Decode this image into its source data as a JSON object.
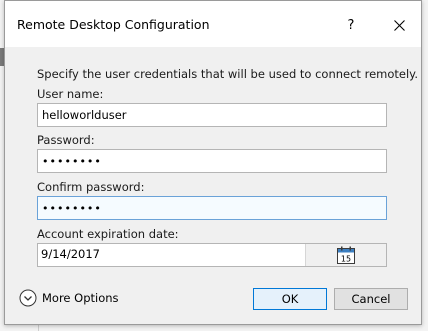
{
  "window": {
    "title": "Remote Desktop Configuration",
    "help_label": "?"
  },
  "form": {
    "description": "Specify the user credentials that will be used to connect remotely.",
    "username": {
      "label": "User name:",
      "value": "helloworlduser"
    },
    "password": {
      "label": "Password:",
      "value": "••••••••"
    },
    "confirm_password": {
      "label": "Confirm password:",
      "value": "••••••••"
    },
    "expiration": {
      "label": "Account expiration date:",
      "value": "9/14/2017",
      "calendar_day": "15"
    }
  },
  "footer": {
    "more_options_label": "More Options",
    "ok_label": "OK",
    "cancel_label": "Cancel"
  },
  "colors": {
    "accent": "#0078d7",
    "focus_border": "#6aa2d8",
    "dialog_body": "#f0f0f0"
  },
  "icons": {
    "close": "close-icon",
    "help": "help-icon",
    "calendar": "calendar-icon",
    "expand": "chevron-down-circle-icon"
  }
}
